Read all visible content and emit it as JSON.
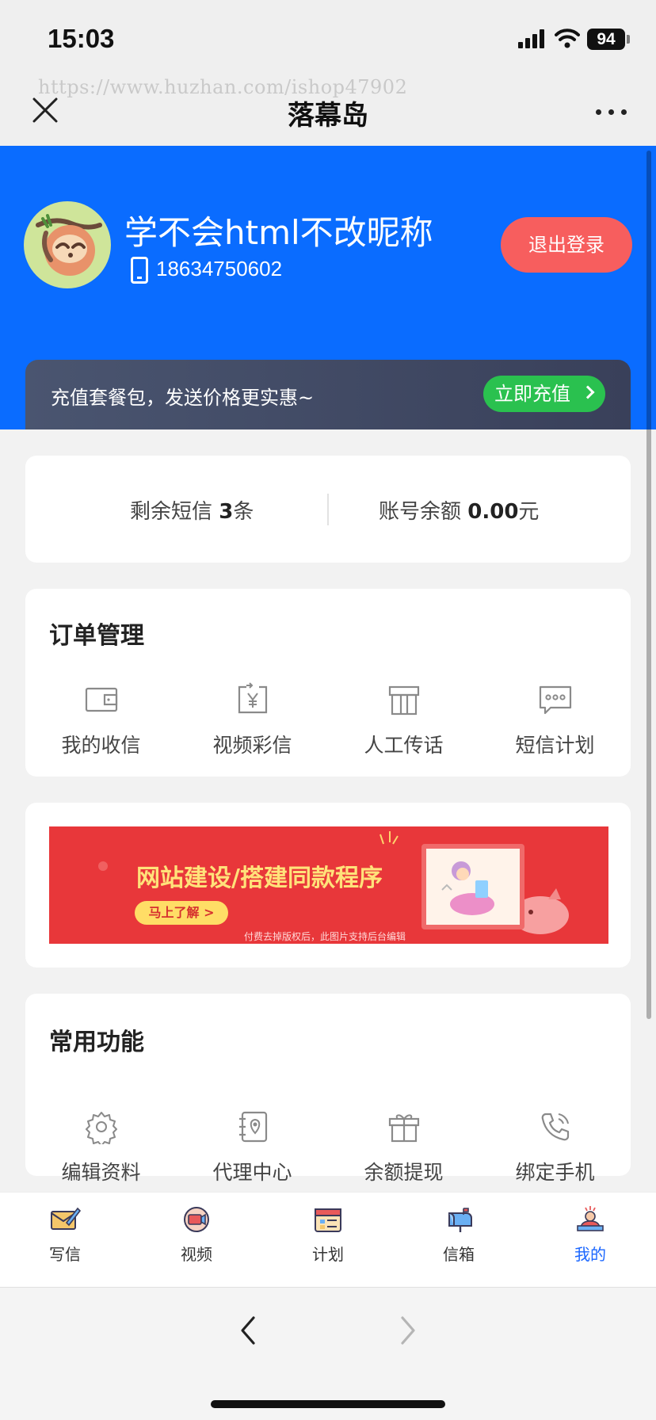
{
  "status_bar": {
    "time": "15:03",
    "battery": "94"
  },
  "navbar": {
    "title": "落幕岛",
    "watermark": "https://www.huzhan.com/ishop47902"
  },
  "profile": {
    "nickname": "学不会html不改昵称",
    "phone": "18634750602",
    "logout_label": "退出登录"
  },
  "promo": {
    "text": "充值套餐包，发送价格更实惠~",
    "button": "立即充值"
  },
  "balance": {
    "sms_prefix": "剩余短信 ",
    "sms_count": "3",
    "sms_unit": "条",
    "account_prefix": "账号余额 ",
    "account_amount": "0.00",
    "account_unit": "元"
  },
  "orders": {
    "title": "订单管理",
    "items": [
      {
        "label": "我的收信",
        "icon": "wallet-icon"
      },
      {
        "label": "视频彩信",
        "icon": "yen-transfer-icon"
      },
      {
        "label": "人工传话",
        "icon": "gift-box-icon"
      },
      {
        "label": "短信计划",
        "icon": "chat-bubble-icon"
      }
    ]
  },
  "banner": {
    "headline": "网站建设/搭建同款程序",
    "button": "马上了解 >",
    "footnote": "付费去掉版权后，此图片支持后台编辑"
  },
  "common": {
    "title": "常用功能",
    "items": [
      {
        "label": "编辑资料",
        "icon": "gear-icon"
      },
      {
        "label": "代理中心",
        "icon": "location-book-icon"
      },
      {
        "label": "余额提现",
        "icon": "gift-icon"
      },
      {
        "label": "绑定手机",
        "icon": "phone-call-icon"
      }
    ]
  },
  "tabbar": {
    "items": [
      {
        "label": "写信",
        "icon": "write-letter-icon",
        "active": false
      },
      {
        "label": "视频",
        "icon": "video-icon",
        "active": false
      },
      {
        "label": "计划",
        "icon": "calendar-icon",
        "active": false
      },
      {
        "label": "信箱",
        "icon": "mailbox-icon",
        "active": false
      },
      {
        "label": "我的",
        "icon": "profile-icon",
        "active": true
      }
    ]
  },
  "colors": {
    "brand_blue": "#0a6cff",
    "logout_red": "#f75e5e",
    "recharge_green": "#2ac14f",
    "active_tab": "#1a66ff"
  }
}
